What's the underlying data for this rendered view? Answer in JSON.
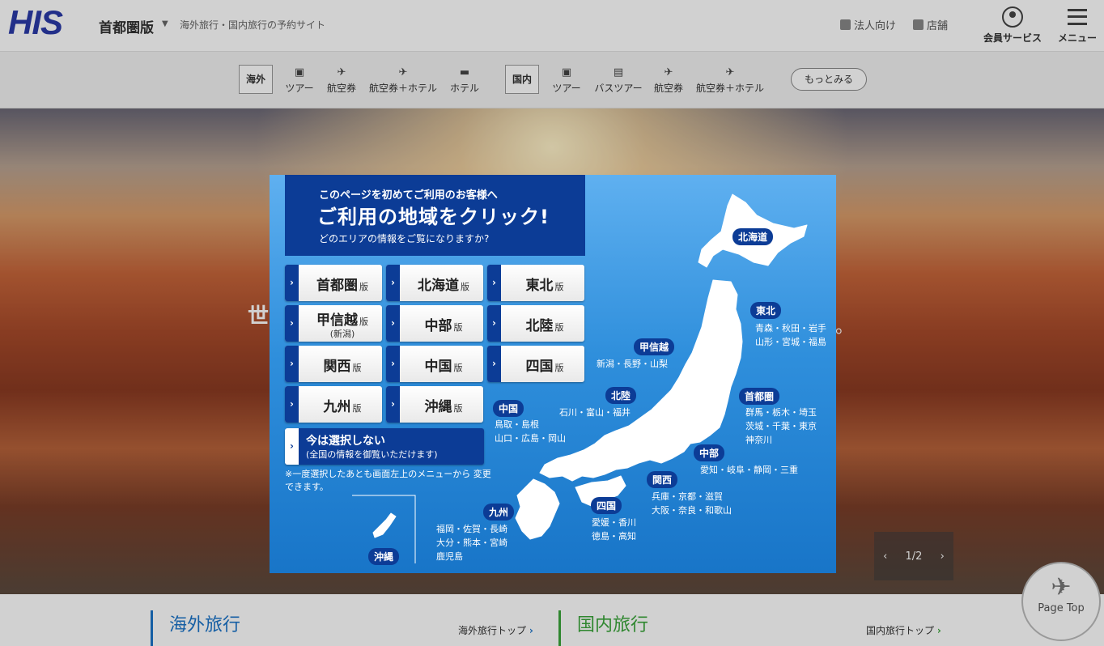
{
  "header": {
    "logo": "HIS",
    "edition": "首都圏版",
    "tagline": "海外旅行・国内旅行の予約サイト",
    "corporate": "法人向け",
    "stores": "店舗",
    "member": "会員サービス",
    "menu": "メニュー"
  },
  "nav": {
    "overseas": {
      "label": "海外",
      "items": [
        "ツアー",
        "航空券",
        "航空券＋ホテル",
        "ホテル"
      ]
    },
    "domestic": {
      "label": "国内",
      "items": [
        "ツアー",
        "バスツアー",
        "航空券",
        "航空券＋ホテル"
      ]
    },
    "more": "もっとみる"
  },
  "hero": {
    "text": "世",
    "text_end": "。",
    "slide": "1/2"
  },
  "bottom": {
    "overseas_title": "海外旅行",
    "overseas_link": "海外旅行トップ",
    "domestic_title": "国内旅行",
    "domestic_link": "国内旅行トップ",
    "page_top": "Page Top"
  },
  "modal": {
    "line1": "このページを初めてご利用のお客様へ",
    "line2": "ご利用の地域をクリック!",
    "line3": "どのエリアの情報をご覧になりますか?",
    "suffix": "版",
    "buttons": [
      {
        "name": "首都圏"
      },
      {
        "name": "北海道"
      },
      {
        "name": "東北"
      },
      {
        "name": "甲信越",
        "sub": "(新潟)"
      },
      {
        "name": "中部"
      },
      {
        "name": "北陸"
      },
      {
        "name": "関西"
      },
      {
        "name": "中国"
      },
      {
        "name": "四国"
      },
      {
        "name": "九州"
      },
      {
        "name": "沖縄"
      }
    ],
    "skip_title": "今は選択しない",
    "skip_sub": "(全国の情報を御覧いただけます)",
    "note": "※一度選択したあとも画面左上のメニューから 変更できます。",
    "map": {
      "hokkaido": {
        "label": "北海道"
      },
      "tohoku": {
        "label": "東北",
        "prefs": [
          "青森・秋田・岩手",
          "山形・宮城・福島"
        ]
      },
      "koshinetsu": {
        "label": "甲信越",
        "prefs": [
          "新潟・長野・山梨"
        ]
      },
      "hokuriku": {
        "label": "北陸",
        "prefs": [
          "石川・富山・福井"
        ]
      },
      "shutoken": {
        "label": "首都圏",
        "prefs": [
          "群馬・栃木・埼玉",
          "茨城・千葉・東京",
          "神奈川"
        ]
      },
      "chugoku": {
        "label": "中国",
        "prefs": [
          "鳥取・島根",
          "山口・広島・岡山"
        ]
      },
      "chubu": {
        "label": "中部",
        "prefs": [
          "愛知・岐阜・静岡・三重"
        ]
      },
      "kansai": {
        "label": "関西",
        "prefs": [
          "兵庫・京都・滋賀",
          "大阪・奈良・和歌山"
        ]
      },
      "shikoku": {
        "label": "四国",
        "prefs": [
          "愛媛・香川",
          "徳島・高知"
        ]
      },
      "kyushu": {
        "label": "九州",
        "prefs": [
          "福岡・佐賀・長崎",
          "大分・熊本・宮崎",
          "鹿児島"
        ]
      },
      "okinawa": {
        "label": "沖縄"
      }
    }
  }
}
